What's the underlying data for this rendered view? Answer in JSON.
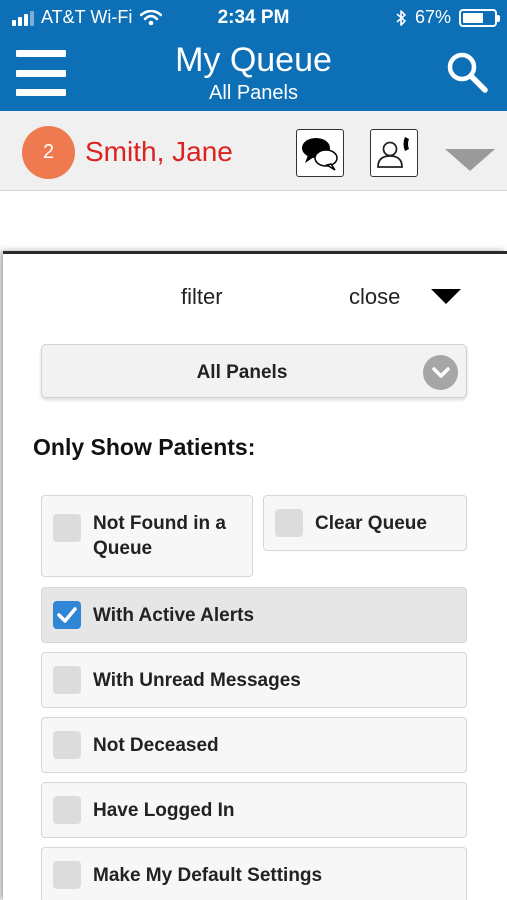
{
  "status_bar": {
    "carrier": "AT&T Wi-Fi",
    "time": "2:34 PM",
    "battery": "67%",
    "battery_level": 0.67
  },
  "nav": {
    "title": "My Queue",
    "subtitle": "All Panels",
    "menu_icon": "hamburger-icon",
    "search_icon": "search-icon"
  },
  "patient": {
    "count": "2",
    "name": "Smith, Jane",
    "chat_icon": "chat-bubble-icon",
    "call_icon": "contact-phone-icon"
  },
  "filter": {
    "filter_label": "filter",
    "close_label": "close",
    "panel_select_value": "All Panels",
    "heading": "Only Show Patients:",
    "options": [
      {
        "label": "Not Found in a Queue",
        "checked": false
      },
      {
        "label": "Clear Queue",
        "checked": false
      },
      {
        "label": "With Active Alerts",
        "checked": true
      },
      {
        "label": "With Unread Messages",
        "checked": false
      },
      {
        "label": "Not Deceased",
        "checked": false
      },
      {
        "label": "Have Logged In",
        "checked": false
      },
      {
        "label": "Make My Default Settings",
        "checked": false
      }
    ]
  },
  "colors": {
    "header_blue": "#0d6fb5",
    "badge_orange": "#ef7a50",
    "name_red": "#dd2222",
    "check_blue": "#2e86d4"
  }
}
